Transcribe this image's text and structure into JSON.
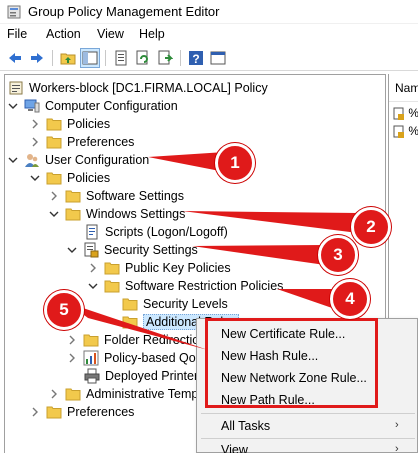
{
  "window": {
    "title": "Group Policy Management Editor"
  },
  "menubar": [
    "File",
    "Action",
    "View",
    "Help"
  ],
  "toolbar": {
    "icons": [
      "back-arrow-icon",
      "forward-arrow-icon",
      "up-folder-icon",
      "show-hide-tree-icon",
      "properties-icon",
      "refresh-icon",
      "export-list-icon",
      "help-icon",
      "console-icon"
    ]
  },
  "tree": {
    "nodes": [
      {
        "label": "Workers-block [DC1.FIRMA.LOCAL] Policy",
        "icon": "gpo-scroll-icon"
      },
      {
        "label": "Computer Configuration",
        "icon": "computer-icon"
      },
      {
        "label": "Policies",
        "icon": "folder-icon"
      },
      {
        "label": "Preferences",
        "icon": "folder-icon"
      },
      {
        "label": "User Configuration",
        "icon": "users-icon"
      },
      {
        "label": "Policies",
        "icon": "folder-icon"
      },
      {
        "label": "Software Settings",
        "icon": "folder-icon"
      },
      {
        "label": "Windows Settings",
        "icon": "folder-icon"
      },
      {
        "label": "Scripts (Logon/Logoff)",
        "icon": "script-icon"
      },
      {
        "label": "Security Settings",
        "icon": "security-icon"
      },
      {
        "label": "Public Key Policies",
        "icon": "folder-icon"
      },
      {
        "label": "Software Restriction Policies",
        "icon": "folder-icon"
      },
      {
        "label": "Security Levels",
        "icon": "folder-icon"
      },
      {
        "label": "Additional Rules",
        "icon": "folder-icon"
      },
      {
        "label": "Folder Redirection",
        "icon": "folder-icon"
      },
      {
        "label": "Policy-based QoS",
        "icon": "chart-icon"
      },
      {
        "label": "Deployed Printers",
        "icon": "printer-icon"
      },
      {
        "label": "Administrative Templates",
        "icon": "folder-icon"
      },
      {
        "label": "Preferences",
        "icon": "folder-icon"
      }
    ]
  },
  "right_pane": {
    "column_header": "Nam",
    "rows": [
      "%",
      "%"
    ]
  },
  "context_menu": {
    "items": [
      "New Certificate Rule...",
      "New Hash Rule...",
      "New Network Zone Rule...",
      "New Path Rule..."
    ],
    "all_tasks": "All Tasks",
    "view": "View"
  },
  "callouts": [
    "1",
    "2",
    "3",
    "4",
    "5"
  ],
  "colors": {
    "callout_red": "#e01a1a",
    "folder_yellow": "#f2c94c",
    "selection_blue": "#cce8ff"
  }
}
